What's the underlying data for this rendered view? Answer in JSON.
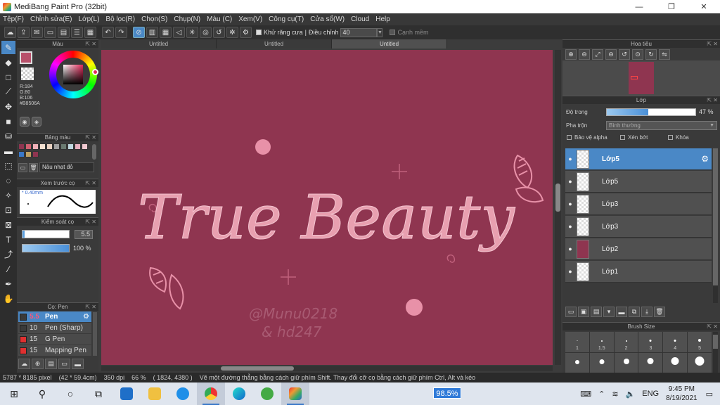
{
  "window": {
    "title": "MediBang Paint Pro (32bit)",
    "minimize": "—",
    "maximize": "❐",
    "close": "✕"
  },
  "menu": [
    "Tệp(F)",
    "Chỉnh sửa(E)",
    "Lớp(L)",
    "Bộ lọc(R)",
    "Chọn(S)",
    "Chụp(N)",
    "Màu (C)",
    "Xem(V)",
    "Công cụ(T)",
    "Cửa sổ(W)",
    "Cloud",
    "Help"
  ],
  "toolbar": {
    "antialias_label": "Khử răng cưa",
    "adjust_label": "Điều chỉnh",
    "adjust_value": "40",
    "edge_label": "Cạnh mềm"
  },
  "color_panel": {
    "title": "Màu",
    "fg_color": "#B8506A",
    "r": "R:184",
    "g": "G:80",
    "b": "B:106",
    "hex": "#B8506A"
  },
  "palette_panel": {
    "title": "Bảng màu",
    "name": "Nâu nhạt đỏ",
    "colors_row1": [
      "#8f3550",
      "#d06070",
      "#f0b0b8",
      "#f3e0d0",
      "#e8d0c0",
      "#a0a0a0",
      "#6a7a70",
      "#c0d8e0",
      "#e8b0c0",
      "#f0c8d0"
    ],
    "colors_row2": [
      "#3a78c8",
      "#c0a060",
      "#8f3550"
    ]
  },
  "brush_preview": {
    "title": "Xem trước cọ",
    "size": "0.40mm"
  },
  "brush_control": {
    "title": "Kiểm soát cọ",
    "size": "5.5",
    "opacity": "100 %",
    "size_fraction": 0.05,
    "opacity_fraction": 1.0
  },
  "brush_list": {
    "title": "Cọ: Pen",
    "items": [
      {
        "size": "5.5",
        "name": "Pen",
        "color": "#3a3a3a"
      },
      {
        "size": "10",
        "name": "Pen (Sharp)",
        "color": "#3a3a3a"
      },
      {
        "size": "15",
        "name": "G Pen",
        "color": "#e03030"
      },
      {
        "size": "15",
        "name": "Mapping Pen",
        "color": "#e03030"
      }
    ]
  },
  "doc_tabs": [
    "Untitled",
    "Untitled",
    "Untitled"
  ],
  "artwork": {
    "text": "True Beauty",
    "watermark1": "@Munu0218",
    "watermark2": "& hd247",
    "canvas_color": "#8f3550",
    "text_color": "#e8a0b0"
  },
  "navigator": {
    "title": "Hoa tiêu"
  },
  "layer_panel": {
    "title": "Lớp",
    "opacity_label": "Độ trong",
    "opacity_value": "47 %",
    "opacity_fraction": 0.47,
    "blend_label": "Pha trộn",
    "blend_value": "Bình thường",
    "protect_alpha": "Bảo vệ alpha",
    "clipping": "Xén bớt",
    "lock": "Khóa",
    "layers": [
      {
        "name": "Lớp5",
        "selected": true,
        "filled": false
      },
      {
        "name": "Lớp5",
        "selected": false,
        "filled": false
      },
      {
        "name": "Lớp3",
        "selected": false,
        "filled": false
      },
      {
        "name": "Lớp3",
        "selected": false,
        "filled": false
      },
      {
        "name": "Lớp2",
        "selected": false,
        "filled": true
      },
      {
        "name": "Lớp1",
        "selected": false,
        "filled": false
      }
    ]
  },
  "brush_size_panel": {
    "title": "Brush Size",
    "sizes": [
      "1",
      "1.5",
      "2",
      "3",
      "4",
      "5"
    ]
  },
  "status": {
    "pixels": "5787 * 8185 pixel",
    "cm": "(42 * 59.4cm)",
    "dpi": "350 dpi",
    "zoom": "66 %",
    "coords": "( 1824, 4380 )",
    "hint": "Vẽ một đường thẳng bằng cách giữ phím Shift. Thay đổi cỡ cọ bằng cách giữ phím Ctrl, Alt và kéo"
  },
  "taskbar": {
    "zoom_badge": "98.5%",
    "lang": "ENG",
    "time": "9:45 PM",
    "date": "8/19/2021"
  }
}
